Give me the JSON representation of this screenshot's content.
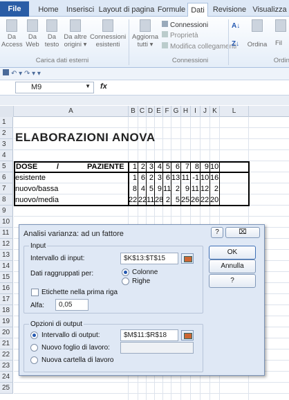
{
  "ribbon": {
    "tabs": [
      "File",
      "Home",
      "Inserisci",
      "Layout di pagina",
      "Formule",
      "Dati",
      "Revisione",
      "Visualizza"
    ],
    "active_tab": "Dati",
    "buttons": [
      {
        "l1": "Da",
        "l2": "Access"
      },
      {
        "l1": "Da",
        "l2": "Web"
      },
      {
        "l1": "Da",
        "l2": "testo"
      },
      {
        "l1": "Da altre",
        "l2": "origini ▾"
      },
      {
        "l1": "Connessioni",
        "l2": "esistenti"
      },
      {
        "l1": "Aggiorna",
        "l2": "tutti ▾"
      }
    ],
    "group_external": "Carica dati esterni",
    "conn_items": [
      "Connessioni",
      "Proprietà",
      "Modifica collegamenti"
    ],
    "group_conn": "Connessioni",
    "sort_label": "Ordina",
    "filter_label": "Fil",
    "group_sort": "Ordina"
  },
  "qat": "↶ ▾ ↷ ▾  ▾",
  "formula_bar": {
    "name_box": "M9",
    "fx": "fx"
  },
  "columns": [
    "A",
    "B",
    "C",
    "D",
    "E",
    "F",
    "G",
    "H",
    "I",
    "J",
    "K",
    "L"
  ],
  "rows": [
    "1",
    "2",
    "3",
    "4",
    "5",
    "6",
    "7",
    "8",
    "9",
    "10",
    "11",
    "12",
    "13",
    "14",
    "15",
    "16",
    "17",
    "18",
    "19",
    "20",
    "21",
    "22",
    "23",
    "24",
    "25"
  ],
  "sheet": {
    "title": "ELABORAZIONI ANOVA",
    "header": {
      "dose": "DOSE",
      "slash": "/",
      "paziente": "PAZIENTE",
      "values": [
        "1",
        "2",
        "3",
        "4",
        "5",
        "6",
        "7",
        "8",
        "9",
        "10"
      ]
    },
    "data": [
      {
        "label": "esistente",
        "values": [
          "1",
          "6",
          "2",
          "3",
          "6",
          "13",
          "11",
          "-1",
          "10",
          "16"
        ]
      },
      {
        "label": "nuovo/bassa",
        "values": [
          "8",
          "4",
          "5",
          "9",
          "11",
          "2",
          "9",
          "11",
          "12",
          "2"
        ]
      },
      {
        "label": "nuovo/media",
        "values": [
          "22",
          "22",
          "11",
          "28",
          "2",
          "5",
          "25",
          "26",
          "22",
          "20"
        ]
      }
    ]
  },
  "dialog": {
    "title": "Analisi varianza: ad un fattore",
    "help": "?",
    "close": "⌧",
    "input_group": "Input",
    "input_range_label": "Intervallo di input:",
    "input_range_value": "$K$13:$T$15",
    "grouped_by_label": "Dati raggruppati per:",
    "opt_columns": "Colonne",
    "opt_rows": "Righe",
    "labels_first_row": "Etichette nella prima riga",
    "alpha_label": "Alfa:",
    "alpha_value": "0,05",
    "output_group": "Opzioni di output",
    "out_range_label": "Intervallo di output:",
    "out_range_value": "$M$11:$R$18",
    "new_sheet_label": "Nuovo foglio di lavoro:",
    "new_wb_label": "Nuova cartella di lavoro",
    "ok": "OK",
    "cancel": "Annulla",
    "help_btn": "?"
  }
}
